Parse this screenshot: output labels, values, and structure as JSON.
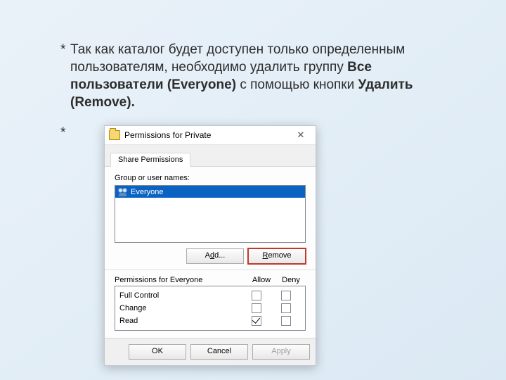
{
  "bullet": {
    "part1": "Так как каталог будет доступен только определенным пользователям, необходимо удалить группу ",
    "bold1": "Все пользователи (Everyone)",
    "mid": " с помощью кнопки ",
    "bold2": "Удалить (Remove)."
  },
  "dialog": {
    "title": "Permissions for Private",
    "tab": "Share Permissions",
    "group_label": "Group or user names:",
    "list_item": "Everyone",
    "add_d": "d",
    "add_rest": "d...",
    "add_pre": "A",
    "remove_R": "R",
    "remove_rest": "emove",
    "perm_label": "Permissions for Everyone",
    "allow": "Allow",
    "deny": "Deny",
    "rows": {
      "full": "Full Control",
      "change": "Change",
      "read": "Read"
    },
    "ok": "OK",
    "cancel": "Cancel",
    "apply": "Apply"
  }
}
